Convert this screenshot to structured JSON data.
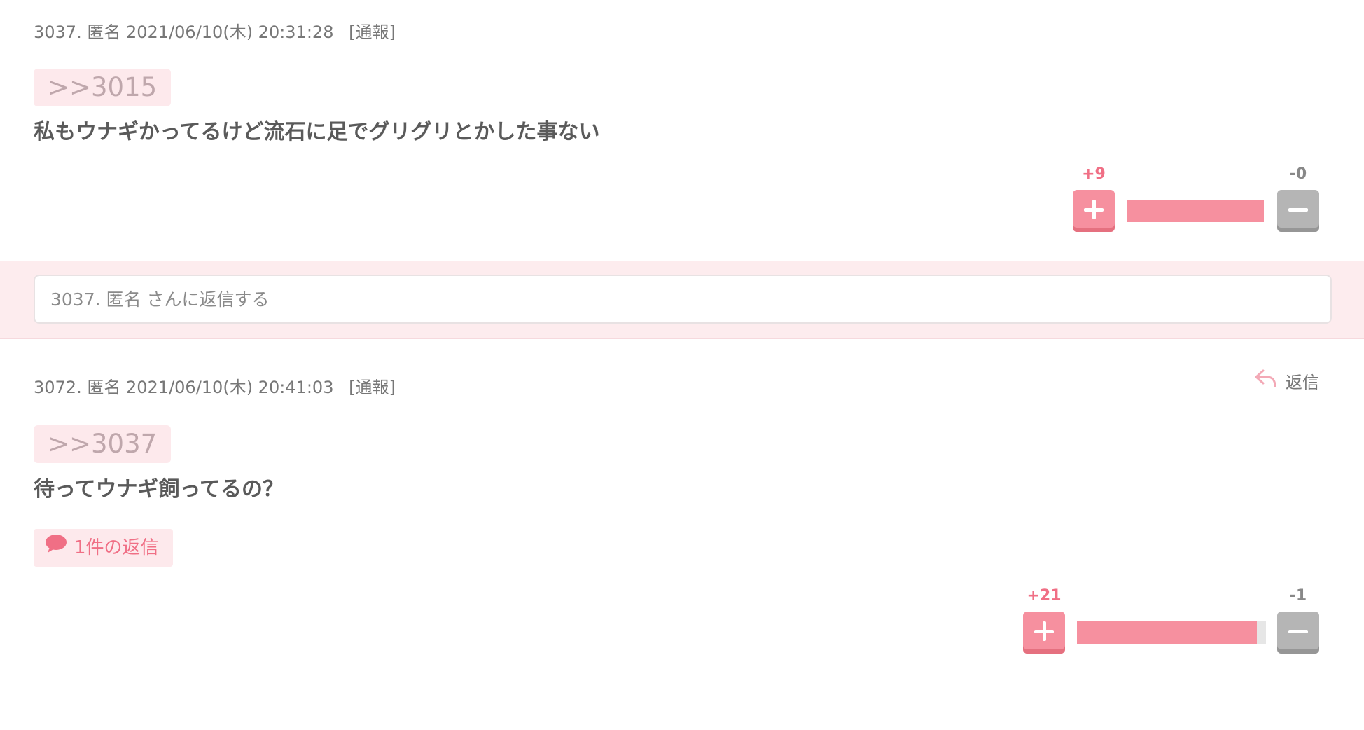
{
  "comments": [
    {
      "number": "3037.",
      "author": "匿名",
      "datetime": "2021/06/10(木) 20:31:28",
      "report_label": "[通報]",
      "anchor": ">>3015",
      "body": "私もウナギかってるけど流石に足でグリグリとかした事ない",
      "plus_count": "+9",
      "minus_count": "-0",
      "plus_ratio": 1.0
    },
    {
      "number": "3072.",
      "author": "匿名",
      "datetime": "2021/06/10(木) 20:41:03",
      "report_label": "[通報]",
      "reply_label": "返信",
      "anchor": ">>3037",
      "body": "待ってウナギ飼ってるの？",
      "replies_label": "1件の返信",
      "plus_count": "+21",
      "minus_count": "-1",
      "plus_ratio": 0.95
    }
  ],
  "reply_box": {
    "placeholder": "3037. 匿名 さんに返信する"
  },
  "icons": {
    "reply": "reply-arrow-icon",
    "speech": "speech-bubble-icon",
    "plus": "plus-icon",
    "minus": "minus-icon"
  },
  "colors": {
    "accent": "#f06f85",
    "plus_button": "#f6909f",
    "minus_button": "#b5b5b5",
    "anchor_bg": "#fde9ec",
    "reply_band_bg": "#fdecee"
  }
}
